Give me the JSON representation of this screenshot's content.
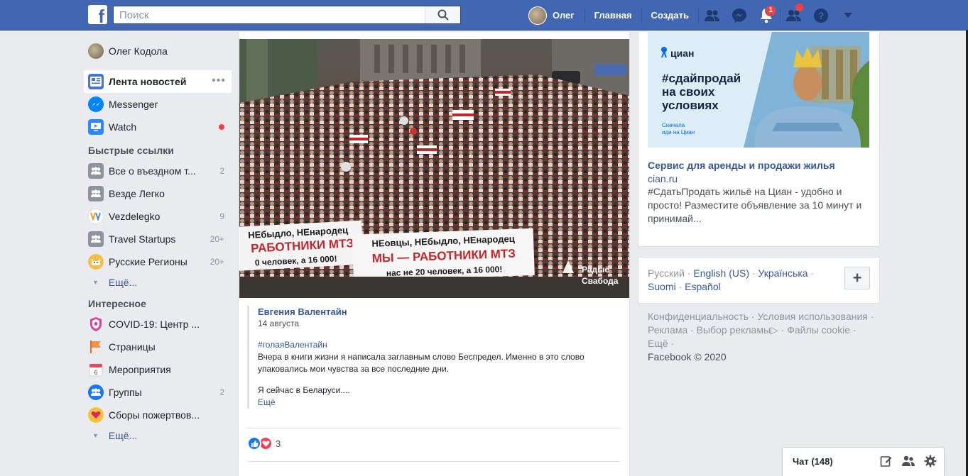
{
  "topbar": {
    "logo": "f",
    "search_placeholder": "Поиск",
    "user_name": "Олег",
    "home": "Главная",
    "create": "Создать",
    "notifications_badge": "1"
  },
  "sidebar": {
    "profile_name": "Олег Кодола",
    "main": [
      {
        "label": "Лента новостей",
        "icon": "news-feed-icon"
      },
      {
        "label": "Messenger",
        "icon": "messenger-icon"
      },
      {
        "label": "Watch",
        "icon": "watch-icon"
      }
    ],
    "shortcuts_title": "Быстрые ссылки",
    "shortcuts": [
      {
        "label": "Все о въездном т...",
        "count": "2"
      },
      {
        "label": "Везде Легко",
        "count": ""
      },
      {
        "label": "Vezdelegko",
        "count": "9"
      },
      {
        "label": "Travel Startups",
        "count": "20+"
      },
      {
        "label": "Русские Регионы",
        "count": "20+"
      }
    ],
    "more_label": "Ещё...",
    "explore_title": "Интересное",
    "explore": [
      {
        "label": "COVID-19: Центр ...",
        "count": ""
      },
      {
        "label": "Страницы",
        "count": ""
      },
      {
        "label": "Мероприятия",
        "count": ""
      },
      {
        "label": "Группы",
        "count": "2"
      },
      {
        "label": "Сборы пожертвов...",
        "count": ""
      }
    ],
    "more_label2": "Ещё..."
  },
  "post": {
    "photo": {
      "banner1_line1": "НЕбыдло, НЕнародец",
      "banner1_line2": "РАБОТНИКИ МТЗ",
      "banner1_line3": "0 человек, а 16 000!",
      "banner2_line1": "НЕовцы, НЕбыдло, НЕнародец",
      "banner2_line2": "МЫ — РАБОТНИКИ МТЗ",
      "banner2_line3": "нас не 20 человек, а 16 000!",
      "watermark_line1": "Радыё",
      "watermark_line2": "Свабода"
    },
    "quote": {
      "author": "Евгения Валентайн",
      "date": "14 августа",
      "hashtag": "#голаяВалентайн",
      "text": "Вчера в книги жизни я написала заглавным слово Беспредел. Именно в это слово упаковались мои чувства за все последние дни.",
      "text2": "Я сейчас в Беларуси....",
      "more": "Ещё"
    },
    "reactions_count": "3"
  },
  "ad": {
    "brand": "циан",
    "headline_line1": "#сдайпродай",
    "headline_line2": "на своих",
    "headline_line3": "условиях",
    "small_line1": "Сначала",
    "small_line2": "иди на Циан",
    "title": "Сервис для аренды и продажи жилья",
    "domain": "cian.ru",
    "description": "#СдатьПродать жильё на Циан - удобно и просто! Разместите объявление за 10 минут и принимай..."
  },
  "languages": {
    "current": "Русский",
    "items": [
      "English (US)",
      "Українська",
      "Suomi",
      "Español"
    ],
    "add_label": "+"
  },
  "footer": {
    "links": [
      "Конфиденциальность",
      "Условия использования",
      "Реклама",
      "Выбор рекламы",
      "Файлы cookie",
      "Ещё"
    ],
    "copyright": "Facebook © 2020"
  },
  "chat": {
    "label": "Чат (148)"
  },
  "colors": {
    "brand_blue": "#4267b2",
    "link_blue": "#365899",
    "badge_red": "#fa3e3e",
    "page_bg": "#e9ebee"
  }
}
